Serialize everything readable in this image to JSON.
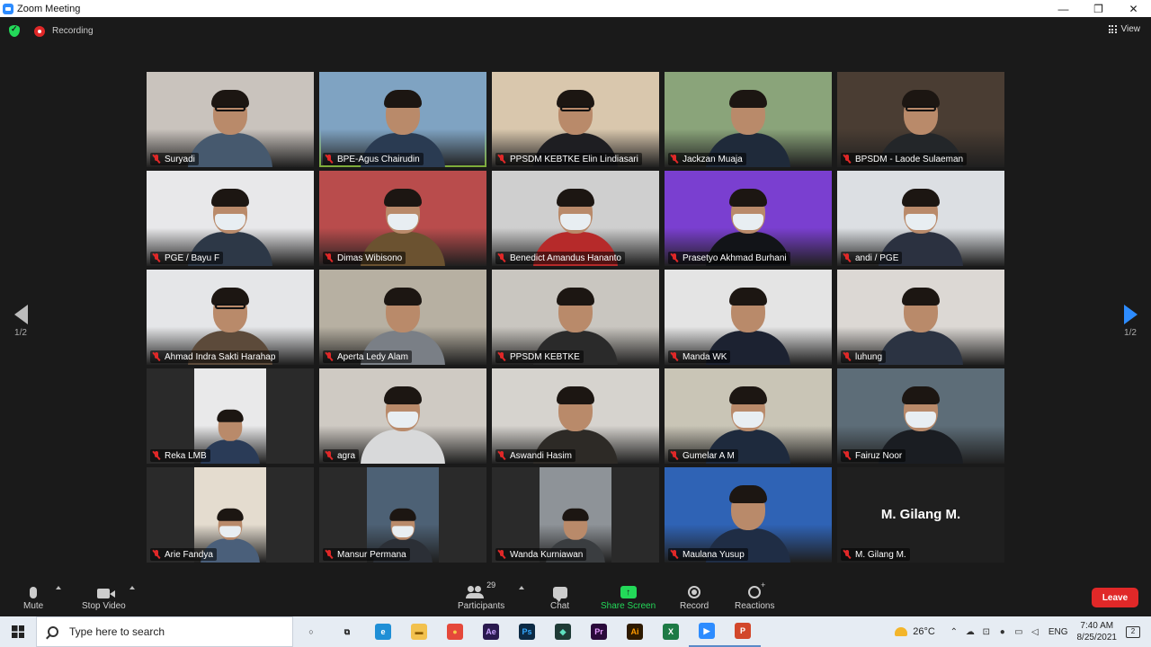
{
  "window": {
    "title": "Zoom Meeting",
    "minimize": "—",
    "maximize": "❐",
    "close": "✕"
  },
  "status": {
    "recording_label": "Recording"
  },
  "view": {
    "label": "View"
  },
  "pagination": {
    "left": "1/2",
    "right": "1/2"
  },
  "participants": [
    {
      "name": "Suryadi",
      "bg": "#c9c3bd",
      "shirt": "#46596e",
      "acc": "glasses",
      "active": false
    },
    {
      "name": "BPE-Agus Chairudin",
      "bg": "#7fa3c2",
      "shirt": "#2a3b52",
      "acc": "",
      "active": true
    },
    {
      "name": "PPSDM KEBTKE Elin Lindiasari",
      "bg": "#d9c7ad",
      "shirt": "#1e1e22",
      "acc": "glasses",
      "active": false
    },
    {
      "name": "Jackzan Muaja",
      "bg": "#8aa47a",
      "shirt": "#1f2a3a",
      "acc": "",
      "active": false
    },
    {
      "name": "BPSDM - Laode Sulaeman",
      "bg": "#4a3d33",
      "shirt": "#232629",
      "acc": "glasses",
      "active": false
    },
    {
      "name": "PGE / Bayu F",
      "bg": "#e8e8ea",
      "shirt": "#2d3847",
      "acc": "mask",
      "active": false
    },
    {
      "name": "Dimas Wibisono",
      "bg": "#b94c4c",
      "shirt": "#6b5230",
      "acc": "mask",
      "active": false
    },
    {
      "name": "Benedict Amandus Hananto",
      "bg": "#cfcfcf",
      "shirt": "#b62a2a",
      "acc": "mask",
      "active": false
    },
    {
      "name": "Prasetyo Akhmad Burhani",
      "bg": "#7a3fd0",
      "shirt": "#121418",
      "acc": "mask",
      "active": false
    },
    {
      "name": "andi / PGE",
      "bg": "#dcdfe3",
      "shirt": "#2b3140",
      "acc": "mask",
      "active": false
    },
    {
      "name": "Ahmad Indra Sakti Harahap",
      "bg": "#e5e6e8",
      "shirt": "#5c4a3a",
      "acc": "glasses",
      "active": false
    },
    {
      "name": "Aperta Ledy Alam",
      "bg": "#b7b0a2",
      "shirt": "#7a7f86",
      "acc": "",
      "active": false
    },
    {
      "name": "PPSDM KEBTKE",
      "bg": "#c9c6c0",
      "shirt": "#2a2a2a",
      "acc": "",
      "active": false
    },
    {
      "name": "Manda WK",
      "bg": "#e4e4e4",
      "shirt": "#1c2231",
      "acc": "",
      "active": false
    },
    {
      "name": "luhung",
      "bg": "#dcd8d4",
      "shirt": "#2b3342",
      "acc": "",
      "active": false
    },
    {
      "name": "Reka LMB",
      "bg": "#e9e9ea",
      "shirt": "#2a3b57",
      "acc": "",
      "active": false,
      "portrait": true
    },
    {
      "name": "agra",
      "bg": "#cfcac3",
      "shirt": "#d8d9da",
      "acc": "mask",
      "active": false
    },
    {
      "name": "Aswandi Hasim",
      "bg": "#d6d3ce",
      "shirt": "#2d2a26",
      "acc": "",
      "active": false
    },
    {
      "name": "Gumelar A M",
      "bg": "#c9c5b6",
      "shirt": "#1e2a3d",
      "acc": "mask",
      "active": false
    },
    {
      "name": "Fairuz Noor",
      "bg": "#5d6d78",
      "shirt": "#1a1d22",
      "acc": "mask",
      "active": false
    },
    {
      "name": "Arie Fandya",
      "bg": "#e4dccf",
      "shirt": "#4a5f7a",
      "acc": "mask",
      "active": false,
      "portrait": true
    },
    {
      "name": "Mansur Permana",
      "bg": "#4d6175",
      "shirt": "#2b2f36",
      "acc": "mask",
      "active": false,
      "portrait": true
    },
    {
      "name": "Wanda Kurniawan",
      "bg": "#8e9398",
      "shirt": "#3a3d40",
      "acc": "",
      "active": false,
      "portrait": true
    },
    {
      "name": "Maulana Yusup",
      "bg": "#2f63b5",
      "shirt": "#1f2d45",
      "acc": "",
      "active": false
    },
    {
      "name": "M. Gilang M.",
      "bg": "#1f1f1f",
      "shirt": "",
      "acc": "",
      "active": false,
      "text_only": true,
      "display": "M. Gilang M."
    }
  ],
  "toolbar": {
    "mute": "Mute",
    "stop_video": "Stop Video",
    "participants": "Participants",
    "participants_count": "29",
    "chat": "Chat",
    "share_screen": "Share Screen",
    "record": "Record",
    "reactions": "Reactions",
    "leave": "Leave"
  },
  "taskbar": {
    "search_placeholder": "Type here to search",
    "apps": [
      {
        "name": "cortana",
        "glyph": "○",
        "bg": "transparent",
        "fg": "#222"
      },
      {
        "name": "task-view",
        "glyph": "⧉",
        "bg": "transparent",
        "fg": "#222"
      },
      {
        "name": "edge",
        "glyph": "e",
        "bg": "#1f8fd6",
        "fg": "#fff"
      },
      {
        "name": "file-explorer",
        "glyph": "▬",
        "bg": "#f2c14e",
        "fg": "#8a5a00"
      },
      {
        "name": "chrome",
        "glyph": "●",
        "bg": "#e5483a",
        "fg": "#f7c948"
      },
      {
        "name": "after-effects",
        "glyph": "Ae",
        "bg": "#2a1a4f",
        "fg": "#c8a2ff"
      },
      {
        "name": "photoshop",
        "glyph": "Ps",
        "bg": "#0c2a44",
        "fg": "#33a8ff"
      },
      {
        "name": "filmora",
        "glyph": "◆",
        "bg": "#1f3b36",
        "fg": "#5fe0c0"
      },
      {
        "name": "premiere",
        "glyph": "Pr",
        "bg": "#2a0a3a",
        "fg": "#e49bff"
      },
      {
        "name": "illustrator",
        "glyph": "Ai",
        "bg": "#2e1a00",
        "fg": "#ff9a00"
      },
      {
        "name": "excel",
        "glyph": "X",
        "bg": "#1d7a45",
        "fg": "#fff"
      },
      {
        "name": "zoom",
        "glyph": "▶",
        "bg": "#2d8cff",
        "fg": "#fff",
        "active": true
      },
      {
        "name": "powerpoint",
        "glyph": "P",
        "bg": "#d2472a",
        "fg": "#fff",
        "active": true
      }
    ],
    "temperature": "26°C",
    "language": "ENG",
    "time": "7:40 AM",
    "date": "8/25/2021",
    "notifications": "2"
  }
}
